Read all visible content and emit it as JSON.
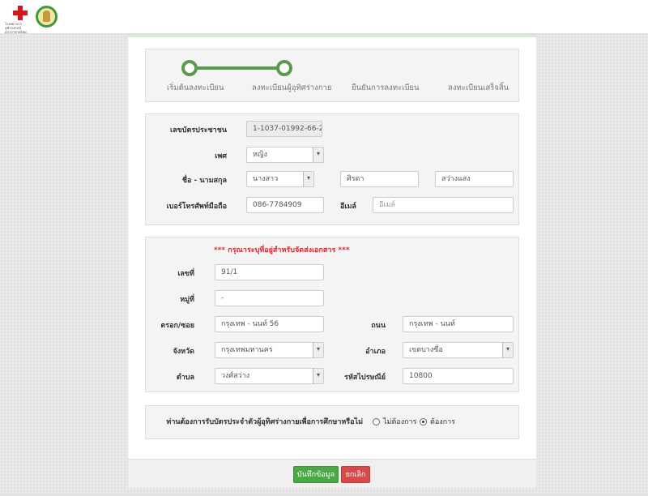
{
  "logo": {
    "org_text": "โรงพยาบาลจุฬาลงกรณ์ สภากาชาดไทย"
  },
  "steps": [
    {
      "label": "เริ่มต้นลงทะเบียน"
    },
    {
      "label": "ลงทะเบียนผู้อุทิศร่างกาย"
    },
    {
      "label": "ยืนยันการลงทะเบียน"
    },
    {
      "label": "ลงทะเบียนเสร็จสิ้น"
    }
  ],
  "steps_completed": 2,
  "personal": {
    "id_label": "เลขบัตรประชาชน",
    "id_value": "1-1037-01992-66-2",
    "gender_label": "เพศ",
    "gender_value": "หญิง",
    "name_label": "ชื่อ - นามสกุล",
    "title_value": "นางสาว",
    "first_name": "ศิรดา",
    "last_name": "สว่างแสง",
    "phone_label": "เบอร์โทรศัพท์มือถือ",
    "phone_value": "086-7784909",
    "email_label": "อีเมล์",
    "email_placeholder": "อีเมล์"
  },
  "address": {
    "note": "*** กรุณาระบุที่อยู่สำหรับจัดส่งเอกสาร ***",
    "house_no_label": "เลขที่",
    "house_no_value": "91/1",
    "moo_label": "หมู่ที่",
    "moo_value": "-",
    "soi_label": "ตรอก/ซอย",
    "soi_value": "กรุงเทพ - นนท์ 56",
    "road_label": "ถนน",
    "road_value": "กรุงเทพ - นนท์",
    "province_label": "จังหวัด",
    "province_value": "กรุงเทพมหานคร",
    "district_label": "อำเภอ",
    "district_value": "เขตบางซื่อ",
    "subdistrict_label": "ตำบล",
    "subdistrict_value": "วงศ์สว่าง",
    "zip_label": "รหัสไปรษณีย์",
    "zip_value": "10800"
  },
  "card_question": {
    "question": "ท่านต้องการรับบัตรประจำตัวผู้อุทิศร่างกายเพื่อการศึกษาหรือไม่",
    "option_no": "ไม่ต้องการ",
    "option_yes": "ต้องการ",
    "selected": "yes"
  },
  "buttons": {
    "save": "บันทึกข้อมูล",
    "cancel": "ยกเลิก"
  },
  "colors": {
    "accent_green": "#5a9a4e",
    "save_green": "#4aa845",
    "cancel_red": "#d84a4a",
    "note_red": "#e0262b"
  }
}
